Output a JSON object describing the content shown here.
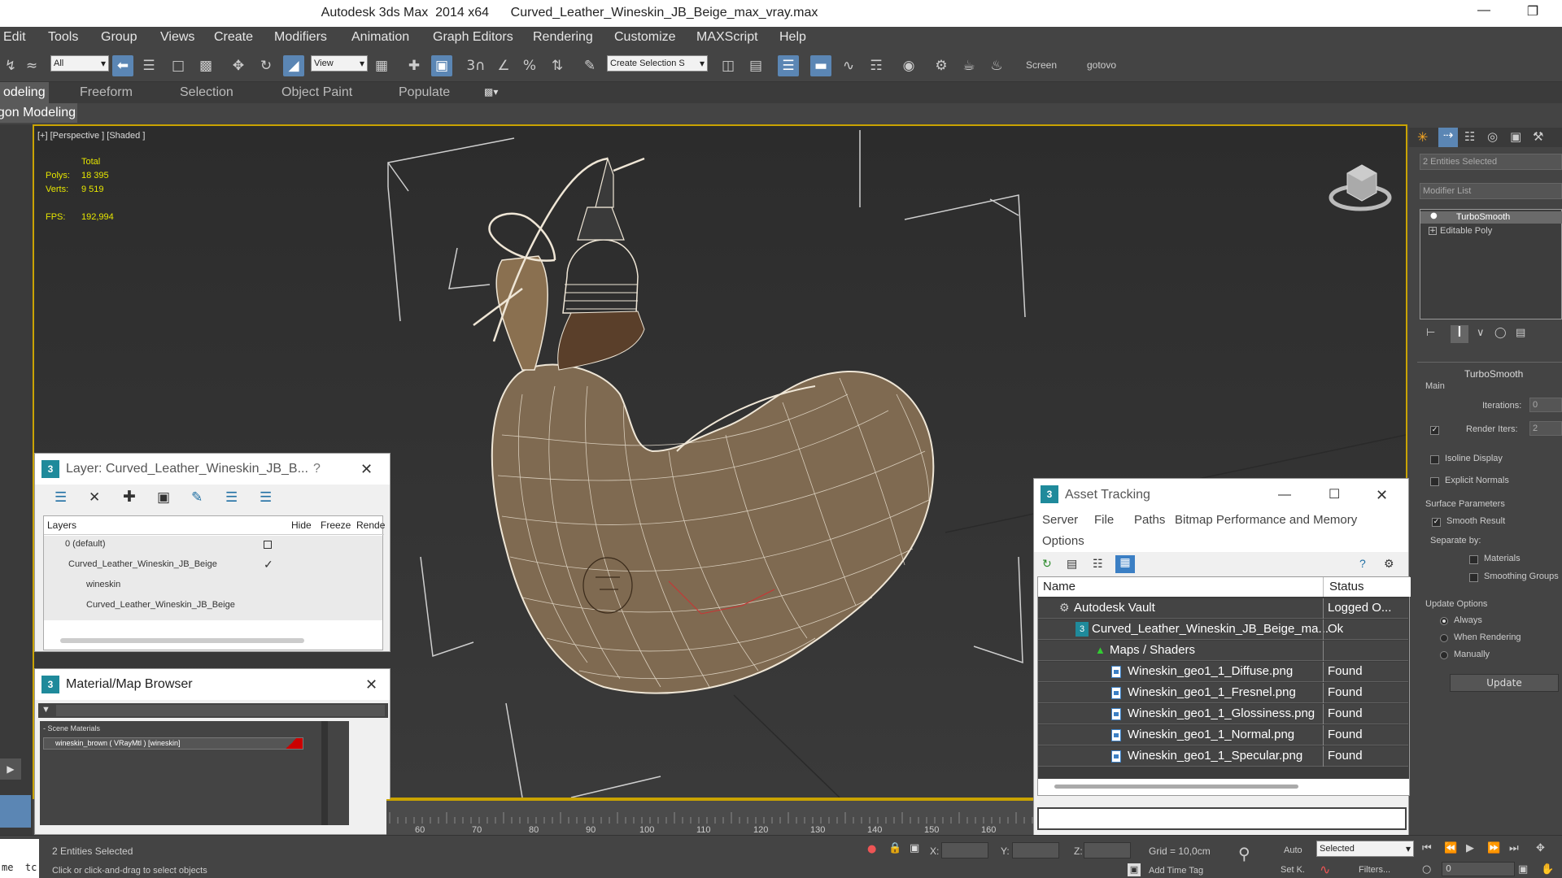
{
  "window": {
    "title": "Autodesk 3ds Max  2014 x64      Curved_Leather_Wineskin_JB_Beige_max_vray.max"
  },
  "menu": [
    "Edit",
    "Tools",
    "Group",
    "Views",
    "Create",
    "Modifiers",
    "Animation",
    "Graph Editors",
    "Rendering",
    "Customize",
    "MAXScript",
    "Help"
  ],
  "toolbar": {
    "filter_select": "All",
    "ref_coord_select": "View",
    "named_selection": "Create Selection S",
    "screen_label": "Screen",
    "gotovo_label": "gotovo"
  },
  "ribbon": {
    "tabs": [
      "odeling",
      "Freeform",
      "Selection",
      "Object Paint",
      "Populate"
    ],
    "sub_label": "Polygon Modeling"
  },
  "viewport": {
    "label": "[+] [Perspective ] [Shaded ]",
    "stats": {
      "total_label": "Total",
      "polys_label": "Polys:",
      "polys_value": "18 395",
      "verts_label": "Verts:",
      "verts_value": "9 519",
      "fps_label": "FPS:",
      "fps_value": "192,994"
    }
  },
  "command_panel": {
    "selection_field": "2 Entities Selected",
    "modifier_list": "Modifier List",
    "stack": [
      "TurboSmooth",
      "Editable Poly"
    ],
    "rollout_title": "TurboSmooth",
    "main_label": "Main",
    "iterations_label": "Iterations:",
    "iterations_value": "0",
    "render_iters_label": "Render Iters:",
    "render_iters_value": "2",
    "isoline_label": "Isoline Display",
    "explicit_normals_label": "Explicit Normals",
    "surface_params_label": "Surface Parameters",
    "smooth_result_label": "Smooth Result",
    "separate_by_label": "Separate by:",
    "materials_label": "Materials",
    "smoothing_groups_label": "Smoothing Groups",
    "update_options_label": "Update Options",
    "always_label": "Always",
    "when_rendering_label": "When Rendering",
    "manually_label": "Manually",
    "update_button": "Update"
  },
  "layer_window": {
    "title": "Layer: Curved_Leather_Wineskin_JB_B...",
    "help": "?",
    "columns": [
      "Layers",
      "Hide",
      "Freeze",
      "Rende"
    ],
    "rows": [
      "0 (default)",
      "Curved_Leather_Wineskin_JB_Beige",
      "wineskin",
      "Curved_Leather_Wineskin_JB_Beige"
    ]
  },
  "material_browser": {
    "title": "Material/Map Browser",
    "group": "- Scene Materials",
    "item": "wineskin_brown  ( VRayMtl )  [wineskin]"
  },
  "asset_tracking": {
    "title": "Asset Tracking",
    "menu": [
      "Server",
      "File",
      "Paths",
      "Bitmap Performance and Memory",
      "Options"
    ],
    "columns": [
      "Name",
      "Status"
    ],
    "rows": [
      {
        "name": "Autodesk Vault",
        "status": "Logged O..."
      },
      {
        "name": "Curved_Leather_Wineskin_JB_Beige_ma...",
        "status": "Ok"
      },
      {
        "name": "Maps / Shaders",
        "status": ""
      },
      {
        "name": "Wineskin_geo1_1_Diffuse.png",
        "status": "Found"
      },
      {
        "name": "Wineskin_geo1_1_Fresnel.png",
        "status": "Found"
      },
      {
        "name": "Wineskin_geo1_1_Glossiness.png",
        "status": "Found"
      },
      {
        "name": "Wineskin_geo1_1_Normal.png",
        "status": "Found"
      },
      {
        "name": "Wineskin_geo1_1_Specular.png",
        "status": "Found"
      }
    ]
  },
  "timeline": {
    "ticks": [
      "60",
      "70",
      "80",
      "90",
      "100",
      "110",
      "120",
      "130",
      "140",
      "150",
      "160"
    ]
  },
  "statusbar": {
    "selection": "2 Entities Selected",
    "prompt": "Click or click-and-drag to select objects",
    "script_prompt": "me  tc",
    "x_label": "X:",
    "y_label": "Y:",
    "z_label": "Z:",
    "grid": "Grid = 10,0cm",
    "add_time_tag": "Add Time Tag",
    "auto": "Auto",
    "set_key": "Set K.",
    "key_filter": "Selected",
    "filters": "Filters...",
    "frame": "0"
  }
}
